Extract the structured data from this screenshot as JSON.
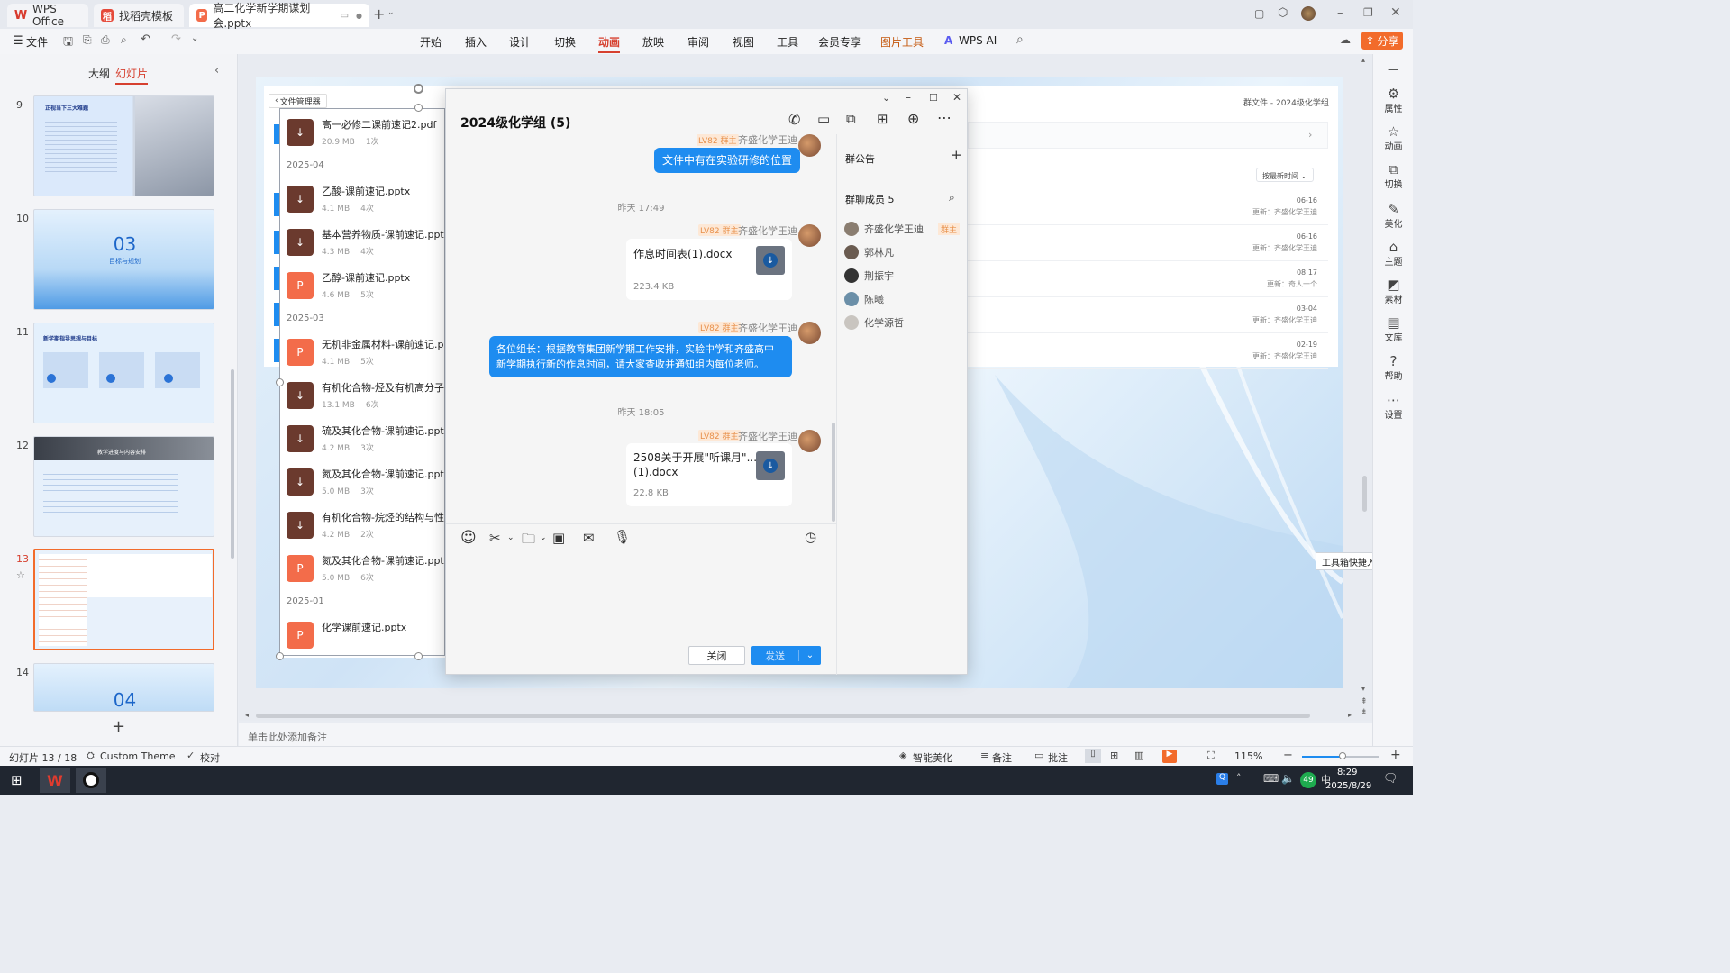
{
  "tabs": {
    "wps": "WPS Office",
    "template": "找稻壳模板",
    "doc": "高二化学新学期谋划会.pptx"
  },
  "ribbon": {
    "file": "文件",
    "menus": [
      "开始",
      "插入",
      "设计",
      "切换",
      "动画",
      "放映",
      "审阅",
      "视图",
      "工具",
      "会员专享",
      "图片工具",
      "WPS AI"
    ],
    "active": "动画",
    "share": "分享"
  },
  "leftpane": {
    "outline_tab": "大纲",
    "slides_tab": "幻灯片",
    "slides": [
      {
        "num": "9",
        "title": "正视当下三大难题"
      },
      {
        "num": "10",
        "big": "03",
        "sub": "目标与规划"
      },
      {
        "num": "11",
        "title": "新学期指导思想与目标"
      },
      {
        "num": "12",
        "title": "教学进度与内容安排"
      },
      {
        "num": "13"
      },
      {
        "num": "14",
        "big": "04"
      }
    ],
    "add": "+"
  },
  "file_manager": {
    "back_label": "文件管理器",
    "groups": [
      {
        "date": "",
        "files": [
          {
            "name": "高一必修二课前速记2.pdf",
            "size": "20.9 MB",
            "count": "1次",
            "type": "dl"
          }
        ]
      },
      {
        "date": "2025-04",
        "files": [
          {
            "name": "乙酸-课前速记.pptx",
            "size": "4.1 MB",
            "count": "4次",
            "type": "dl"
          },
          {
            "name": "基本营养物质-课前速记.pptx",
            "size": "4.3 MB",
            "count": "4次",
            "type": "dl"
          },
          {
            "name": "乙醇-课前速记.pptx",
            "size": "4.6 MB",
            "count": "5次",
            "type": "ppt"
          }
        ]
      },
      {
        "date": "2025-03",
        "files": [
          {
            "name": "无机非金属材料-课前速记.pp",
            "size": "4.1 MB",
            "count": "5次",
            "type": "ppt"
          },
          {
            "name": "有机化合物-烃及有机高分子-",
            "size": "13.1 MB",
            "count": "6次",
            "type": "dl"
          },
          {
            "name": "硫及其化合物-课前速记.pptx",
            "size": "4.2 MB",
            "count": "3次",
            "type": "dl"
          },
          {
            "name": "氮及其化合物-课前速记.pptx",
            "size": "5.0 MB",
            "count": "3次",
            "type": "dl"
          },
          {
            "name": "有机化合物-烷烃的结构与性质",
            "size": "4.2 MB",
            "count": "2次",
            "type": "dl"
          },
          {
            "name": "氮及其化合物-课前速记.pptx",
            "size": "5.0 MB",
            "count": "6次",
            "type": "ppt"
          }
        ]
      },
      {
        "date": "2025-01",
        "files": [
          {
            "name": "化学课前速记.pptx",
            "size": "",
            "count": "",
            "type": "ppt"
          }
        ]
      }
    ]
  },
  "group_files": {
    "title": "群文件 - 2024级化学组",
    "sort": "按最新时间",
    "rows": [
      {
        "date": "06-16",
        "by": "更新：齐盛化学王迪"
      },
      {
        "date": "06-16",
        "by": "更新：齐盛化学王迪"
      },
      {
        "date": "08:17",
        "by": "更新：奇人一个"
      },
      {
        "date": "03-04",
        "by": "更新：齐盛化学王迪"
      },
      {
        "date": "02-19",
        "by": "更新：齐盛化学王迪"
      }
    ]
  },
  "chat": {
    "title": "2024级化学组 (5)",
    "messages": [
      {
        "kind": "text",
        "text": "文件中有在实验研修的位置"
      },
      {
        "kind": "time",
        "text": "昨天 17:49"
      },
      {
        "kind": "file",
        "level": "LV82 群主",
        "sender": "齐盛化学王迪",
        "name": "作息时间表(1).docx",
        "size": "223.4 KB"
      },
      {
        "kind": "notice",
        "level": "LV82 群主",
        "sender": "齐盛化学王迪",
        "line1": "各位组长：根据教育集团新学期工作安排，实验中学和齐盛高中",
        "line2": "新学期执行新的作息时间，请大家查收并通知组内每位老师。"
      },
      {
        "kind": "time",
        "text": "昨天 18:05"
      },
      {
        "kind": "file",
        "level": "LV82 群主",
        "sender": "齐盛化学王迪",
        "name_line1": "2508关于开展\"听课月\"...",
        "name_line2": "(1).docx",
        "size": "22.8 KB"
      }
    ],
    "top_level": "LV82 群主",
    "top_sender": "齐盛化学王迪",
    "close_label": "关闭",
    "send_label": "发送",
    "announcement": "群公告",
    "members_label": "群聊成员 5",
    "members": [
      {
        "name": "齐盛化学王迪",
        "badge": "群主"
      },
      {
        "name": "郭林凡"
      },
      {
        "name": "荆振宇"
      },
      {
        "name": "陈曦"
      },
      {
        "name": "化学源哲"
      }
    ]
  },
  "rightbar": [
    "属性",
    "动画",
    "切换",
    "美化",
    "主题",
    "素材",
    "文库",
    "帮助",
    "设置"
  ],
  "tooltip": "工具箱快捷入口",
  "notes_placeholder": "单击此处添加备注",
  "status": {
    "slide": "幻灯片 13 / 18",
    "theme": "Custom Theme",
    "proof": "校对",
    "beautify": "智能美化",
    "notes": "备注",
    "comment": "批注",
    "zoom": "115%"
  },
  "taskbar": {
    "time": "8:29",
    "date": "2025/8/29",
    "badge": "49"
  }
}
